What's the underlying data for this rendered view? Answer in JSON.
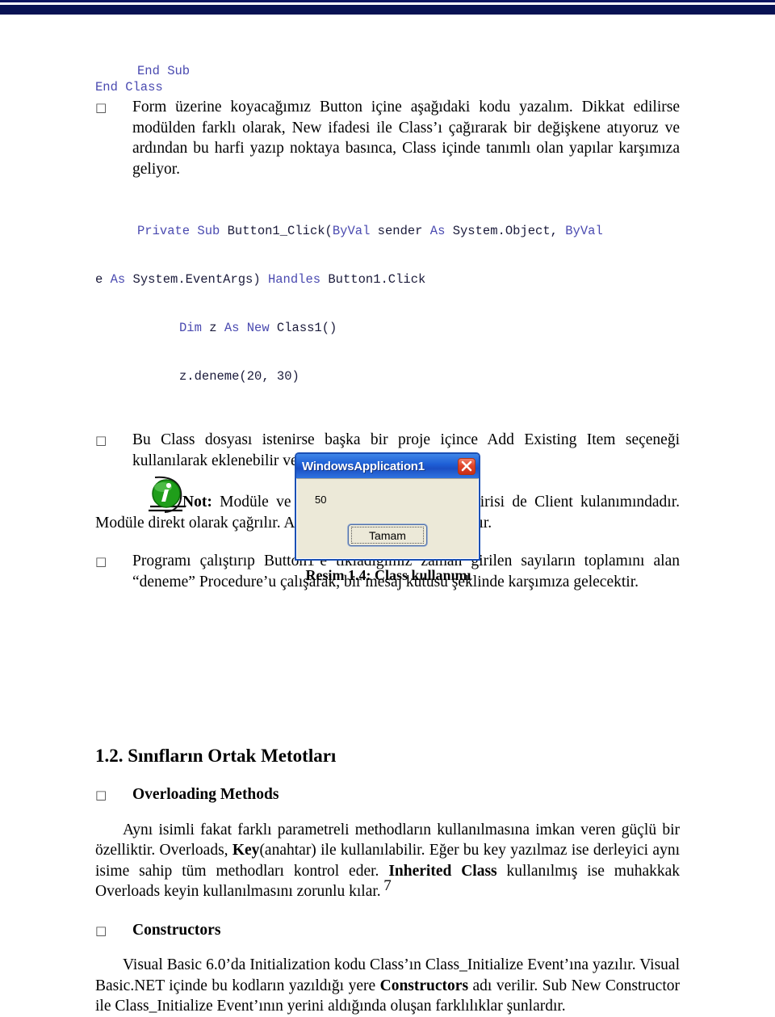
{
  "document": {
    "page_number": "7",
    "bullet_glyph": "□"
  },
  "code_top": {
    "line1": "End Sub",
    "line2": "End Class"
  },
  "bullets": {
    "b1": "Form üzerine koyacağımız Button içine aşağıdaki kodu yazalım. Dikkat edilirse modülden farklı olarak, New ifadesi ile Class’ı çağırarak bir değişkene atıyoruz ve ardından bu harfi yazıp noktaya basınca, Class içinde tanımlı olan yapılar karşımıza geliyor.",
    "b2": "Bu Class dosyası istenirse başka bir proje içince Add Existing Item seçeneği kullanılarak eklenebilir ve o projede de kullanılabilir.",
    "b3": "Programı çalıştırıp Button1’e tıkladığımız zaman girilen sayıların toplamını alan “deneme” Procedure’u çalışarak, bir mesaj kutusu şeklinde karşımıza gelecektir.",
    "b4": "Overloading Methods",
    "b5": "Constructors"
  },
  "code_block": {
    "l1_kw_a": "Private Sub ",
    "l1_id_a": "Button1_Click(",
    "l1_kw_b": "ByVal",
    "l1_id_b": " sender ",
    "l1_kw_c": "As",
    "l1_id_c": " System.Object, ",
    "l1_kw_d": "ByVal",
    "l2_id_a": "e ",
    "l2_kw_a": "As",
    "l2_id_b": " System.EventArgs) ",
    "l2_kw_b": "Handles",
    "l2_id_c": " Button1.Click",
    "l3_kw_a": "Dim",
    "l3_id_a": " z ",
    "l3_kw_b": "As New",
    "l3_id_b": " Class1()",
    "l4_id_a": "z.deneme(20, 30)"
  },
  "note": {
    "icon_name": "info-icon",
    "label": "Not:",
    "text": " Modüle ve Class arasında farklardan birisi de Client kulanımındadır. Modüle direkt olarak çağrılır. Ancak Class, New ile tanımlanır."
  },
  "dialog": {
    "title": "WindowsApplication1",
    "message": "50",
    "ok_button": "Tamam",
    "caption": "Resim 1.4: Class kullanımı",
    "titlebar_color": "#1e5fd6",
    "close_color": "#d3381c",
    "client_color": "#ece9d8"
  },
  "section": {
    "heading": "1.2. Sınıfların Ortak Metotları"
  },
  "overloading": {
    "p1_a": "Aynı isimli fakat farklı parametreli methodların kullanılmasına imkan veren güçlü bir özelliktir. Overloads, ",
    "p1_b": "Key",
    "p1_c": "(anahtar) ile kullanılabilir. Eğer bu key yazılmaz ise derleyici aynı isime sahip tüm methodları kontrol eder. ",
    "p1_d": "Inherited Class",
    "p1_e": " kullanılmış ise muhakkak Overloads keyin kullanılmasını zorunlu kılar."
  },
  "constructors": {
    "p1_a": "Visual Basic 6.0’da Initialization kodu Class’ın Class_Initialize Event’ına yazılır. Visual Basic.NET içinde bu kodların yazıldığı yere ",
    "p1_b": "Constructors",
    "p1_c": " adı verilir. Sub New Constructor ile Class_Initialize Event’ının yerini aldığında oluşan farklılıklar şunlardır."
  },
  "colors": {
    "header_bar": "#081253",
    "header_rule": "#0b1560",
    "code_keyword": "#4a4ab0",
    "code_identifier": "#1a1a3a",
    "info_icon_green": "#22a01e"
  }
}
